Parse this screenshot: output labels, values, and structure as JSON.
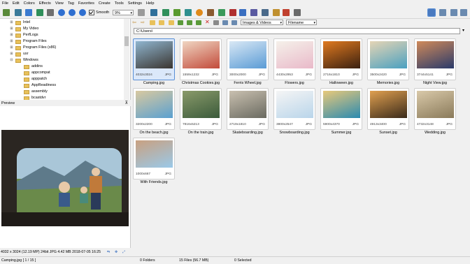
{
  "menu": [
    "File",
    "Edit",
    "Colors",
    "Effects",
    "View",
    "Tag",
    "Favorites",
    "Create",
    "Tools",
    "Settings",
    "Help"
  ],
  "toolbar": {
    "smooth_label": "Smooth",
    "zoom_value": "9%"
  },
  "nav": {
    "filter_value": "Images & Videos",
    "sort_value": "Filename"
  },
  "path": "C:\\Users\\",
  "tree": [
    {
      "label": "Intel",
      "indent": 1
    },
    {
      "label": "My Video",
      "indent": 1
    },
    {
      "label": "PerfLogs",
      "indent": 1
    },
    {
      "label": "Program Files",
      "indent": 1
    },
    {
      "label": "Program Files (x86)",
      "indent": 1
    },
    {
      "label": "usr",
      "indent": 1
    },
    {
      "label": "Windows",
      "indent": 1
    },
    {
      "label": "addins",
      "indent": 2
    },
    {
      "label": "appcompat",
      "indent": 2
    },
    {
      "label": "apppatch",
      "indent": 2
    },
    {
      "label": "AppReadiness",
      "indent": 2
    },
    {
      "label": "assembly",
      "indent": 2
    },
    {
      "label": "bcastdvr",
      "indent": 2
    }
  ],
  "preview": {
    "label": "Preview",
    "info": "4032 x 3024 (12.19 MP)  24bit  JPG   4.42 MB    2018-07-05 16:25"
  },
  "files": [
    {
      "name": "Camping.jpg",
      "dims": "4032x3024",
      "type": "JPG",
      "selected": true
    },
    {
      "name": "Christmas Cookies.jpg",
      "dims": "1559x1232",
      "type": "JPG"
    },
    {
      "name": "Ferris Wheel.jpg",
      "dims": "3000x2000",
      "type": "JPG"
    },
    {
      "name": "Flowers.jpg",
      "dims": "4430x2953",
      "type": "JPG"
    },
    {
      "name": "Halloween.jpg",
      "dims": "2716x1810",
      "type": "JPG"
    },
    {
      "name": "Memories.jpg",
      "dims": "3500x2420",
      "type": "JPG"
    },
    {
      "name": "Night View.jpg",
      "dims": "3744x5141",
      "type": "JPG"
    },
    {
      "name": "On the beach.jpg",
      "dims": "3200x2200",
      "type": "JPG"
    },
    {
      "name": "On the train.jpg",
      "dims": "7816x5213",
      "type": "JPG"
    },
    {
      "name": "Skateboarding.jpg",
      "dims": "2719x1810",
      "type": "JPG"
    },
    {
      "name": "Snowboarding.jpg",
      "dims": "3800x2547",
      "type": "JPG"
    },
    {
      "name": "Summer.jpg",
      "dims": "5900x4370",
      "type": "JPG"
    },
    {
      "name": "Sunset.jpg",
      "dims": "4913x3400",
      "type": "JPG"
    },
    {
      "name": "Wedding.jpg",
      "dims": "4732x3148",
      "type": "JPG"
    },
    {
      "name": "With Friends.jpg",
      "dims": "1000x667",
      "type": "JPG"
    }
  ],
  "status": {
    "file": "Camping.jpg [ 1 / 15 ]",
    "folders": "0 Folders",
    "files": "15 Files (56.7 MB)",
    "selected": "0 Selected"
  },
  "colors": {
    "accent": "#5a8fd6",
    "selected_bg": "#dbe8fa"
  }
}
